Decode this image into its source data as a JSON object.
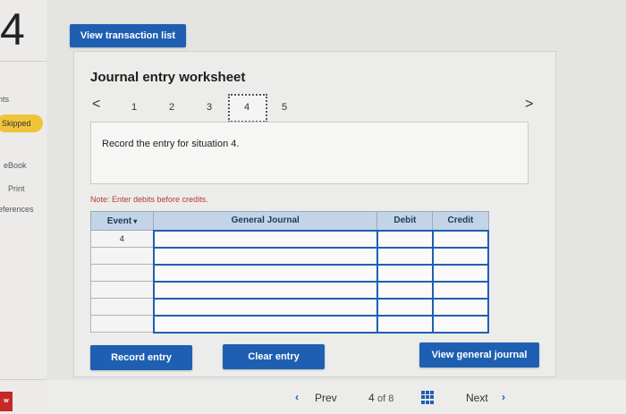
{
  "question_number": "4",
  "left_rail": {
    "points_label": "nts",
    "skipped_label": "Skipped",
    "ebook": "eBook",
    "print": "Print",
    "references": "eferences",
    "red_badge": "w"
  },
  "top": {
    "view_transaction_list": "View transaction list"
  },
  "worksheet": {
    "title": "Journal entry worksheet",
    "pages": [
      "1",
      "2",
      "3",
      "4",
      "5"
    ],
    "current_page": "4",
    "prev_arrow": "<",
    "next_arrow": ">",
    "prompt": "Record the entry for situation 4.",
    "note": "Note: Enter debits before credits.",
    "table": {
      "headers": {
        "event": "Event",
        "general_journal": "General Journal",
        "debit": "Debit",
        "credit": "Credit"
      },
      "first_event": "4",
      "row_count": 6
    },
    "buttons": {
      "record": "Record entry",
      "clear": "Clear entry",
      "view_journal": "View general journal"
    }
  },
  "footer_nav": {
    "prev": "Prev",
    "position": "4",
    "of_label": "of 8",
    "next": "Next"
  },
  "colors": {
    "accent": "#1f5fb2",
    "skipped": "#f0c43a",
    "note": "#b73a2f",
    "header": "#c3d4e6"
  }
}
